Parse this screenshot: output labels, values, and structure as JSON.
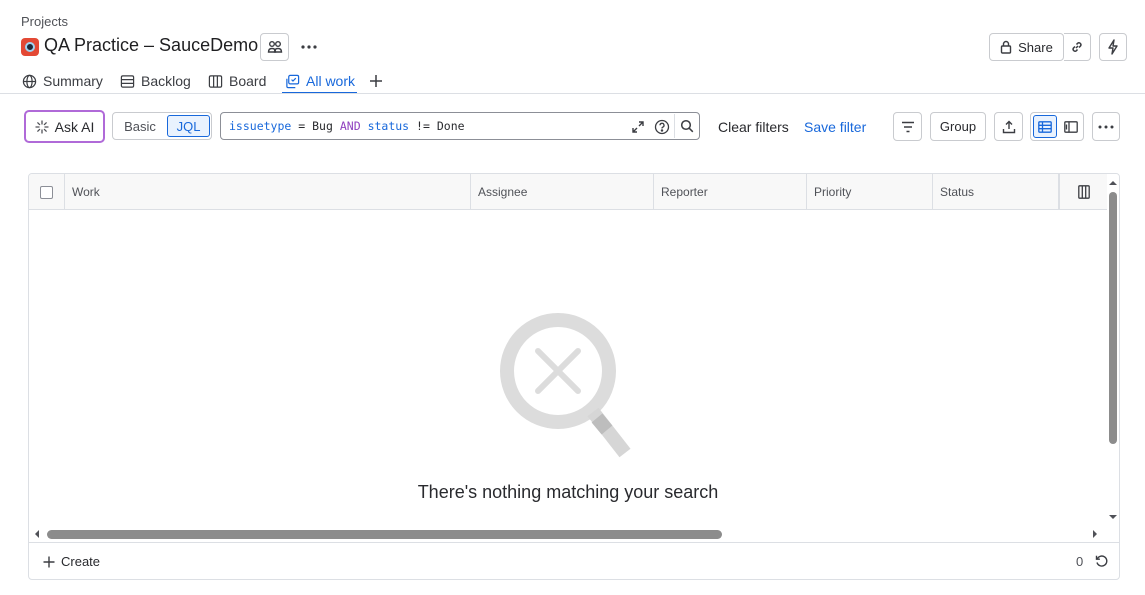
{
  "breadcrumb": "Projects",
  "project": {
    "title": "QA Practice – SauceDemo"
  },
  "header": {
    "share_label": "Share"
  },
  "tabs": [
    {
      "label": "Summary",
      "icon": "globe-icon"
    },
    {
      "label": "Backlog",
      "icon": "backlog-icon"
    },
    {
      "label": "Board",
      "icon": "board-icon"
    },
    {
      "label": "All work",
      "icon": "all-work-icon",
      "active": true
    }
  ],
  "filter": {
    "ask_ai_label": "Ask AI",
    "mode_basic": "Basic",
    "mode_jql": "JQL",
    "mode_selected": "JQL",
    "jql": {
      "field1": "issuetype",
      "op1": "=",
      "value1": "Bug",
      "and": "AND",
      "field2": "status",
      "op2": "!=",
      "value2": "Done"
    },
    "clear_label": "Clear filters",
    "save_label": "Save filter",
    "group_label": "Group"
  },
  "table": {
    "columns": [
      "Work",
      "Assignee",
      "Reporter",
      "Priority",
      "Status"
    ],
    "empty_message": "There's nothing matching your search"
  },
  "footer": {
    "create_label": "Create",
    "count": "0"
  },
  "colors": {
    "accent": "#1868db",
    "ai_border": "#b06ad8",
    "jql_keyword": "#8f3fbf"
  }
}
